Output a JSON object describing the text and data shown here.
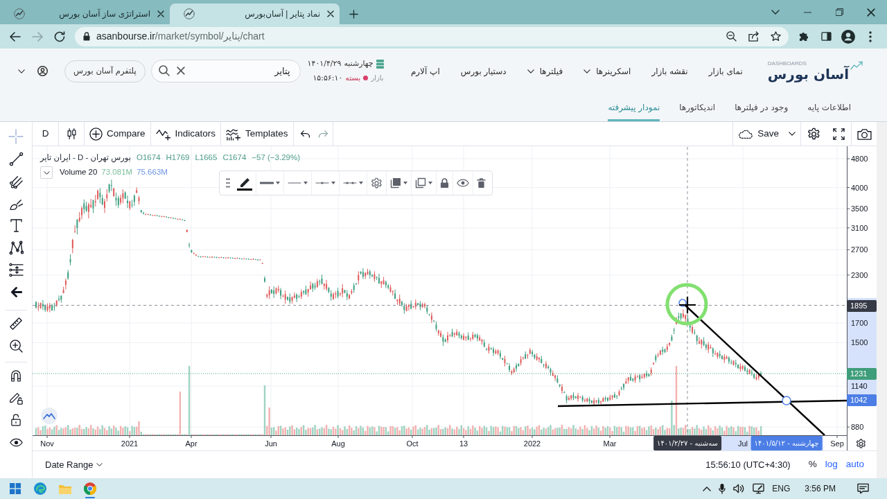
{
  "browser": {
    "tabs": [
      {
        "title": "نماد پتایر | آسان‌بورس",
        "selected": true
      },
      {
        "title": "استراتژی ساز آسان بورس",
        "selected": false
      }
    ],
    "history_buttons": [
      {
        "disabled": false
      },
      {
        "disabled": true
      }
    ],
    "address": {
      "host": "asanbourse.ir",
      "path": "/market/symbol/پتایر/chart"
    }
  },
  "site_header": {
    "logo": {
      "name": "آسان بورس",
      "caption": "DASHBOARDS"
    },
    "nav": [
      {
        "label": "نمای بازار",
        "dropdown": false
      },
      {
        "label": "نقشه بازار",
        "dropdown": false
      },
      {
        "label": "اسکرینرها",
        "dropdown": true
      },
      {
        "label": "فیلترها",
        "dropdown": true
      },
      {
        "label": "دستیار بورس",
        "dropdown": false
      },
      {
        "label": "اپ آلارم",
        "dropdown": false
      }
    ],
    "market": {
      "day": "چهارشنبه",
      "date": "۱۴۰۱/۴/۲۹",
      "label": "بازار",
      "open": false,
      "status": "بسته",
      "time": "۱۵:۵۶:۱۰"
    },
    "search": {
      "value": "پتایر"
    },
    "platform_button": "پلتفرم آسان بورس"
  },
  "subtabs": [
    {
      "label": "اطلاعات پایه",
      "selected": false
    },
    {
      "label": "وجود در فیلترها",
      "selected": false
    },
    {
      "label": "اندیکاتورها",
      "selected": false
    },
    {
      "label": "نمودار پیشرفته",
      "selected": true
    }
  ],
  "chart": {
    "toolbar": {
      "interval": "D",
      "buttons": [
        {
          "kind": "templates",
          "label": "Templates"
        },
        {
          "kind": "indicators",
          "label": "Indicators"
        },
        {
          "kind": "compare",
          "label": "Compare"
        }
      ],
      "history": [
        {
          "disabled": false
        },
        {
          "disabled": true
        }
      ],
      "save": "Save"
    },
    "legend": {
      "title": "ایران تایر - D - بورس تهران",
      "values": [
        "−57 (−3.29%)",
        "C1674",
        "L1665",
        "H1769",
        "O1674"
      ],
      "volume": {
        "label": "Volume 20",
        "values": [
          {
            "text": "75.663M",
            "color": "#6b93e3"
          },
          {
            "text": "73.081M",
            "color": "#7cbf9a"
          }
        ]
      }
    },
    "price_labels": [
      "4800",
      "4000",
      "3500",
      "3100",
      "2700",
      "2300",
      "1700",
      "1500",
      "1140",
      "880"
    ],
    "price_badges": [
      {
        "text": "1895",
        "kind": "crosshair"
      },
      {
        "text": "1231",
        "kind": "last_price"
      },
      {
        "text": "1042",
        "kind": "drawing"
      }
    ],
    "time_labels": [
      "Sep",
      "Jul",
      "Mar",
      "2022",
      "13",
      "Oct",
      "Aug",
      "Jun",
      "Apr",
      "2021",
      "Nov"
    ],
    "time_badges": [
      {
        "text": "چهارشنبه - ۱۴۰۱/۵/۱۲",
        "kind": "drawing"
      },
      {
        "text": "سه‌شنبه - ۱۴۰۱/۲/۲۷",
        "kind": "crosshair"
      }
    ]
  },
  "bottom_bar": {
    "date_range": "Date Range",
    "clock": "15:56:10 (UTC+4:30)",
    "scale_buttons": [
      {
        "label": "auto",
        "on": true
      },
      {
        "label": "log",
        "on": true
      },
      {
        "label": "%",
        "on": false
      }
    ]
  },
  "taskbar": {
    "apps": [
      {
        "running": false
      },
      {
        "running": false
      },
      {
        "running": false
      },
      {
        "running": true
      }
    ],
    "language": "ENG",
    "time": "3:56 PM"
  }
}
